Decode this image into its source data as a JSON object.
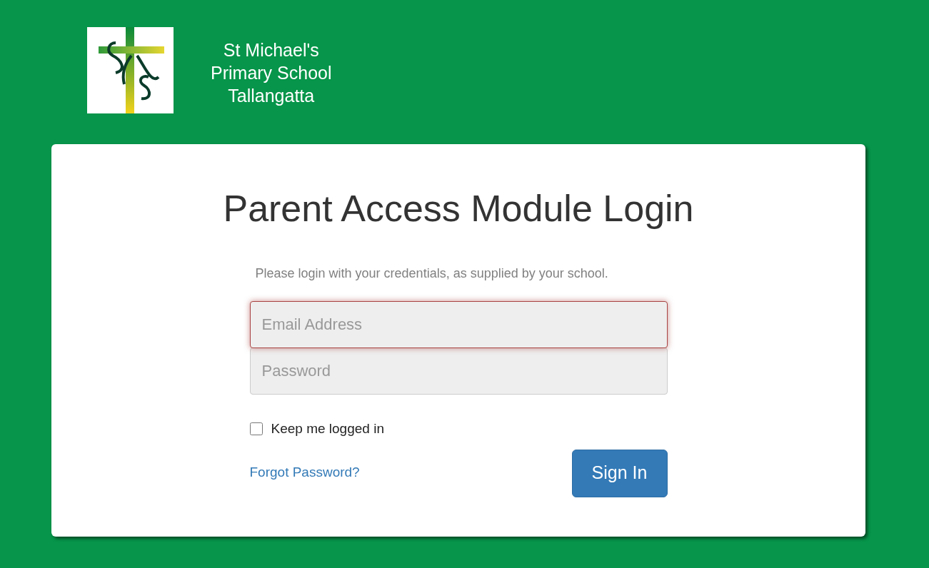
{
  "header": {
    "school_name": [
      "St Michael's",
      "Primary School",
      "Tallangatta"
    ]
  },
  "login": {
    "title": "Parent Access Module Login",
    "instructions": "Please login with your credentials, as supplied by your school.",
    "fields": [
      {
        "placeholder": "Email Address",
        "focused": true
      },
      {
        "placeholder": "Password",
        "focused": false
      }
    ],
    "keep_logged_in": {
      "label": "Keep me logged in",
      "checked": false
    },
    "forgot_link": "Forgot Password?",
    "submit": "Sign In"
  }
}
